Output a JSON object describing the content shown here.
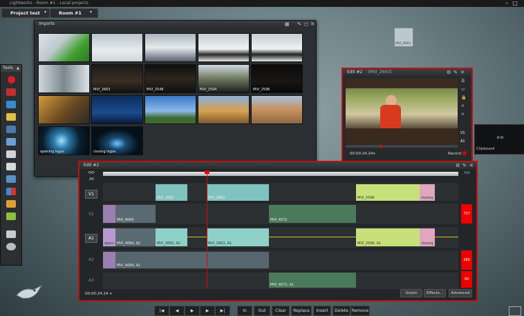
{
  "window": {
    "title": "Lightworks - Room #1  -  Local projects"
  },
  "topbar": {
    "project_label": "Project test",
    "room_label": "Room #1"
  },
  "imports": {
    "title": "Imports",
    "items": [
      {
        "label": ""
      },
      {
        "label": ""
      },
      {
        "label": ""
      },
      {
        "label": ""
      },
      {
        "label": ""
      },
      {
        "label": ""
      },
      {
        "label": "MVI_2663"
      },
      {
        "label": "MVI_2548"
      },
      {
        "label": "MVI_2594"
      },
      {
        "label": "MVI_2596"
      },
      {
        "label": ""
      },
      {
        "label": ""
      },
      {
        "label": ""
      },
      {
        "label": ""
      },
      {
        "label": ""
      },
      {
        "label": "opening logos"
      },
      {
        "label": "closing logos"
      }
    ]
  },
  "desktop_clip": {
    "label": "MVI_2663"
  },
  "tools": {
    "title": "Tools"
  },
  "viewer": {
    "title": "Edit #2",
    "subtitle": "[MVI_2663]",
    "timecode": "00:00:24.24",
    "record_label": "Record"
  },
  "clipboard": {
    "label": "Clipboard"
  },
  "timeline": {
    "title": "Edit #2",
    "track_label_top": "All",
    "tracks": [
      {
        "name": "V1"
      },
      {
        "name": "V2"
      },
      {
        "name": "A1"
      },
      {
        "name": "A2"
      },
      {
        "name": "A3"
      }
    ],
    "clips": {
      "v1_a": "MVI_2663",
      "v1_b": "MVI_2663",
      "v1_c": "MVI_2596",
      "v1_d": "closing",
      "v2_a": "MVI_4064",
      "v2_b": "MVI_4072",
      "a1_a": "openi",
      "a1_b": "MVI_4064, A1",
      "a1_c": "MVI_2663, A1",
      "a1_d": "MVI_2663, A1",
      "a1_e": "MVI_2596, A1",
      "a1_f": "closing",
      "a2_a": "MVI_4064, A1",
      "a3_a": "MVI_4072, A1"
    },
    "end_badges": {
      "v2": "737",
      "a2": "380",
      "a3": "99"
    },
    "timecode": "00:00:24.24",
    "buttons": {
      "unjoin": "Unjoin",
      "effects": "Effects...",
      "advanced": "Advanced"
    }
  },
  "transport": {
    "buttons": [
      "|◀",
      "◀",
      "▶",
      "▶",
      "▶|",
      "In",
      "Out",
      "Clear",
      "Replace",
      "Insert",
      "Delete",
      "Remove"
    ]
  },
  "colors": {
    "accent_red": "#c01010",
    "clip_teal": "#7fc3c0",
    "clip_lime": "#c7e07a",
    "clip_pink": "#e0a6c0"
  }
}
